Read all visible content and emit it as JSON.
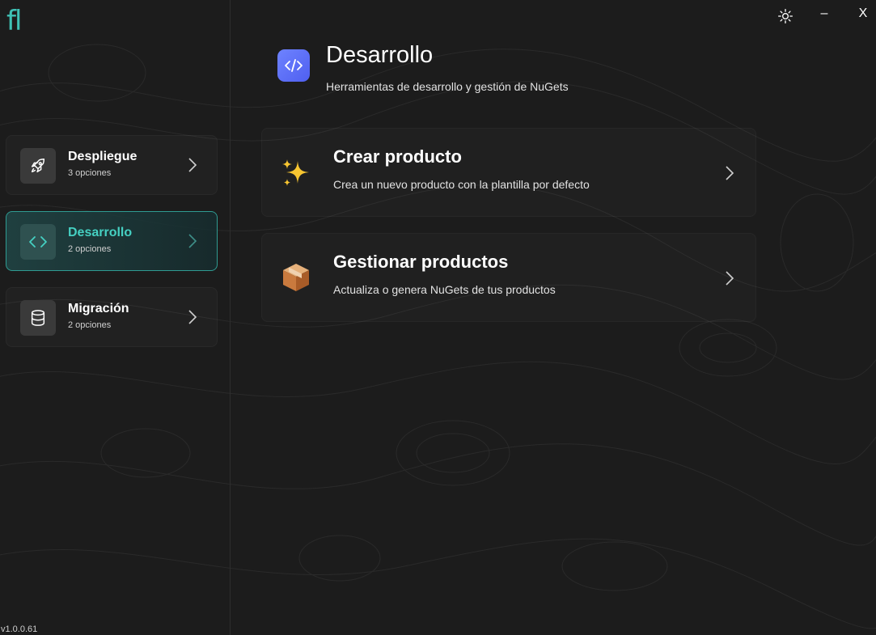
{
  "app": {
    "logo_text": "fl",
    "version": "v1.0.0.61"
  },
  "window_controls": {
    "minimize_label": "–",
    "close_label": "X"
  },
  "sidebar": {
    "items": [
      {
        "title": "Despliegue",
        "subtitle": "3 opciones",
        "icon": "rocket-icon",
        "active": false
      },
      {
        "title": "Desarrollo",
        "subtitle": "2 opciones",
        "icon": "code-icon",
        "active": true
      },
      {
        "title": "Migración",
        "subtitle": "2 opciones",
        "icon": "database-icon",
        "active": false
      }
    ]
  },
  "main": {
    "title": "Desarrollo",
    "subtitle": "Herramientas de desarrollo y gestión de NuGets",
    "header_icon": "code-icon",
    "cards": [
      {
        "title": "Crear producto",
        "description": "Crea un nuevo producto con la plantilla por defecto",
        "icon": "sparkles-icon"
      },
      {
        "title": "Gestionar productos",
        "description": "Actualiza o genera NuGets de tus productos",
        "icon": "package-icon"
      }
    ]
  },
  "colors": {
    "accent": "#45d0c2",
    "background": "#1c1c1c",
    "header_icon_bg": "#5f70f7"
  }
}
